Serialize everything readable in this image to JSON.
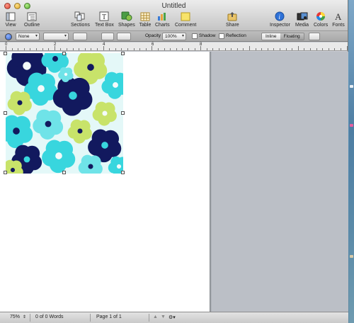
{
  "window": {
    "title": "Untitled"
  },
  "toolbar": {
    "view": "View",
    "outline": "Outline",
    "sections": "Sections",
    "textbox": "Text Box",
    "shapes": "Shapes",
    "table": "Table",
    "charts": "Charts",
    "comment": "Comment",
    "share": "Share",
    "inspector": "Inspector",
    "media": "Media",
    "colors": "Colors",
    "fonts": "Fonts"
  },
  "format_bar": {
    "stroke_style": "None",
    "opacity_label": "Opacity",
    "opacity_value": "100%",
    "shadow_label": "Shadow",
    "reflection_label": "Reflection",
    "wrap_inline": "Inline",
    "wrap_floating": "Floating"
  },
  "ruler": {
    "marks": [
      "0",
      "2",
      "4",
      "6",
      "8"
    ]
  },
  "status": {
    "zoom": "75%",
    "word_count": "0 of 0 Words",
    "page": "Page 1 of 1"
  },
  "colors": {
    "navy": "#12195e",
    "cyan": "#38d6de",
    "aqua": "#6fe3e8",
    "lime": "#c8e36a",
    "white": "#f3fbfb"
  }
}
